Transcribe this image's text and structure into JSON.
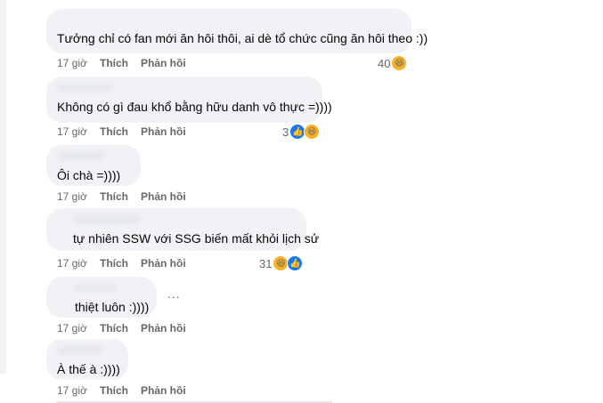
{
  "comments": [
    {
      "text": "Tưởng chỉ có fan mới ăn hôi thôi, ai dè tổ chức cũng ăn hôi theo :))",
      "time": "17 giờ",
      "like": "Thích",
      "reply": "Phản hồi",
      "reaction_count": "40",
      "reactions": [
        "haha-icon"
      ]
    },
    {
      "text": "Không có gì đau khổ bằng hữu danh vô thực =))))",
      "time": "17 giờ",
      "like": "Thích",
      "reply": "Phản hồi",
      "reaction_count": "3",
      "reactions": [
        "like-icon",
        "haha-icon"
      ]
    },
    {
      "text": "Ôi chà =))))",
      "time": "17 giờ",
      "like": "Thích",
      "reply": "Phản hồi",
      "reaction_count": "",
      "reactions": []
    },
    {
      "text": "tự nhiên SSW với SSG biến mất khỏi lịch sử",
      "time": "17 giờ",
      "like": "Thích",
      "reply": "Phản hồi",
      "reaction_count": "31",
      "reactions": [
        "haha-icon",
        "like-icon"
      ]
    },
    {
      "text": "thiệt luôn :))))",
      "time": "17 giờ",
      "like": "Thích",
      "reply": "Phản hồi",
      "reaction_count": "",
      "reactions": [],
      "more": "..."
    },
    {
      "text": "À thế à :))))",
      "time": "17 giờ",
      "like": "Thích",
      "reply": "Phản hồi",
      "reaction_count": "",
      "reactions": []
    }
  ],
  "colors": {
    "bubble": "#f0f2f5",
    "meta": "#65676b",
    "like_badge": "#1877f2",
    "haha_badge": "#f7b125"
  }
}
